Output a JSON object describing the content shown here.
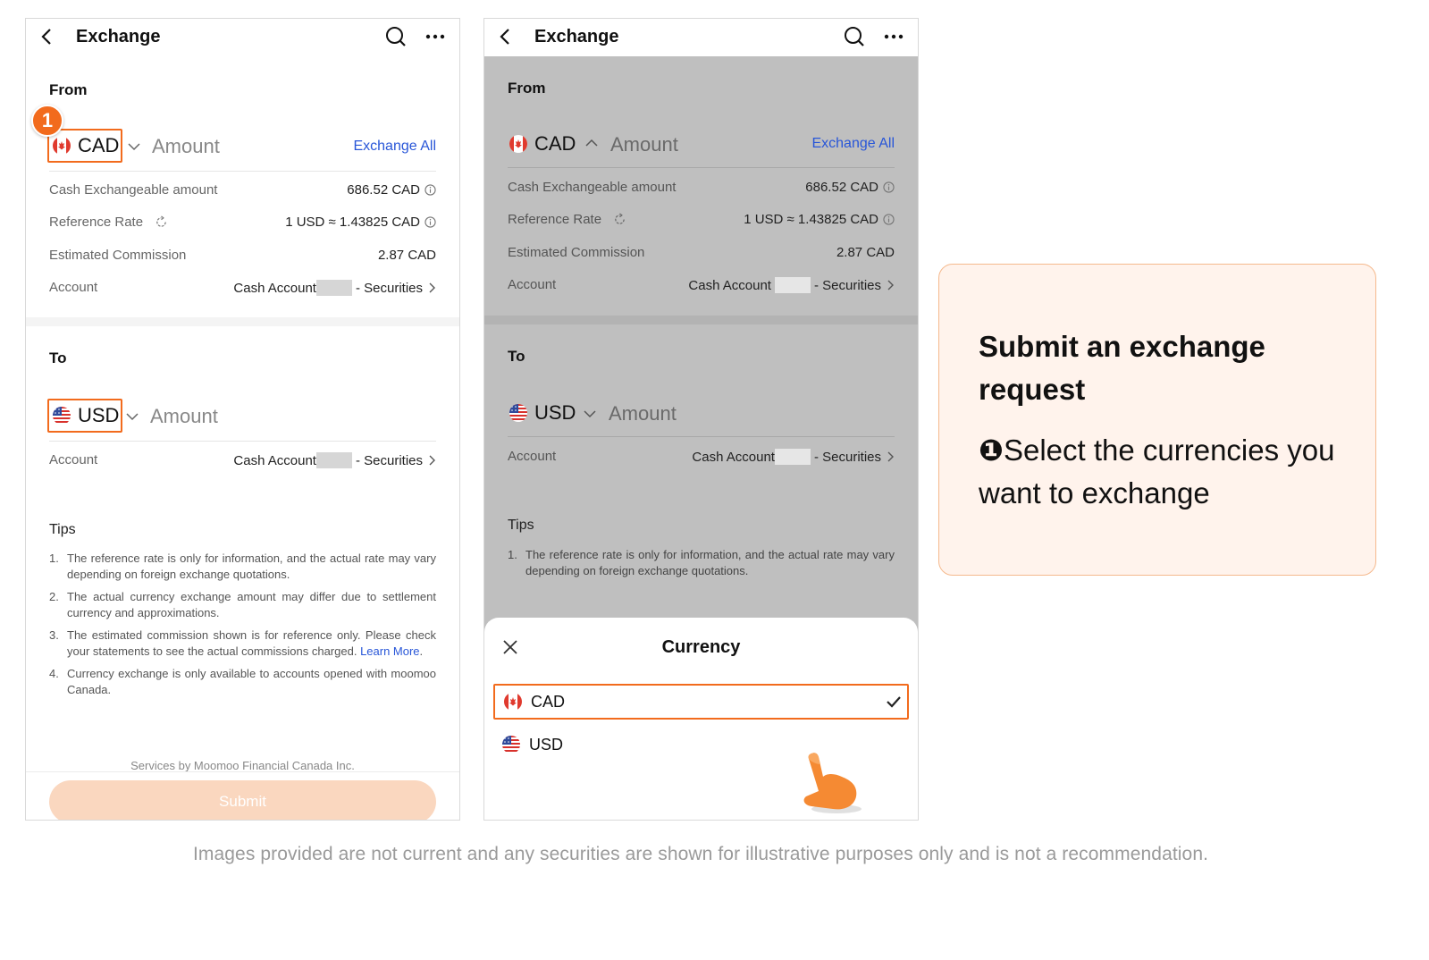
{
  "colors": {
    "accent": "#f26b1d",
    "link": "#2856d8",
    "submit_disabled": "#fad7bf",
    "overlay": "#bfbfbf",
    "callout_bg": "#fff3ec"
  },
  "nav": {
    "title": "Exchange",
    "back_icon": "chevron-left-icon",
    "search_icon": "search-icon",
    "more_icon": "more-horizontal-icon"
  },
  "from": {
    "label": "From",
    "currency": "CAD",
    "flag": "canada-flag-icon",
    "amount_placeholder": "Amount",
    "exchange_all": "Exchange All",
    "rows": {
      "cash_label": "Cash Exchangeable amount",
      "cash_value": "686.52 CAD",
      "rate_label": "Reference Rate",
      "rate_value": "1 USD ≈ 1.43825 CAD",
      "commission_label": "Estimated Commission",
      "commission_value": "2.87 CAD",
      "account_label": "Account",
      "account_value_prefix": "Cash Account",
      "account_value_suffix": "- Securities"
    }
  },
  "to": {
    "label": "To",
    "currency": "USD",
    "flag": "us-flag-icon",
    "amount_placeholder": "Amount",
    "account_label": "Account",
    "account_value_prefix": "Cash Account",
    "account_value_suffix": "- Securities"
  },
  "tips": {
    "title": "Tips",
    "items": [
      {
        "num": "1.",
        "text": "The reference rate is only for information, and the actual rate may vary depending on foreign exchange quotations."
      },
      {
        "num": "2.",
        "text": "The actual currency exchange amount may differ due to settlement currency and approximations."
      },
      {
        "num": "3.",
        "text": "The estimated commission shown is for reference only. Please check your statements to see the actual commissions charged.",
        "link": "Learn More"
      },
      {
        "num": "4.",
        "text": "Currency exchange is only available to accounts opened with moomoo Canada."
      }
    ]
  },
  "footer": {
    "services": "Services by Moomoo Financial Canada Inc.",
    "submit": "Submit"
  },
  "step_badge": "1",
  "sheet": {
    "title": "Currency",
    "options": [
      {
        "code": "CAD",
        "flag": "canada-flag-icon",
        "selected": true
      },
      {
        "code": "USD",
        "flag": "us-flag-icon",
        "selected": false
      }
    ]
  },
  "callout": {
    "title": "Submit an exchange request",
    "step_marker": "❶",
    "step_text": "Select the currencies you want to exchange"
  },
  "disclaimer": "Images provided are not current and any securities are shown for illustrative purposes only and is not a recommendation."
}
